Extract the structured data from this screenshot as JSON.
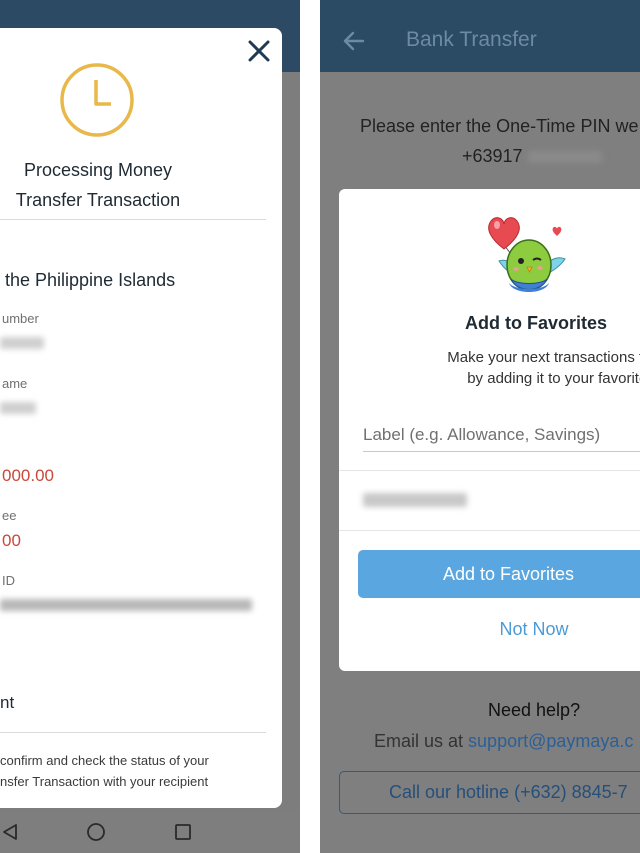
{
  "left_screen": {
    "close_icon": "close-icon",
    "status_icon": "clock-icon",
    "title_line1": "Processing Money",
    "title_line2": "Transfer Transaction",
    "bank_name": "the Philippine Islands",
    "fields": {
      "account_number_label": "umber",
      "account_name_label": "ame",
      "amount_value": "000.00",
      "fee_label": "ee",
      "fee_value": "00",
      "reference_label": "ID"
    },
    "section_title": "nt",
    "note_line1": "confirm and check the status of your",
    "note_line2": "nsfer Transaction with your recipient",
    "colors": {
      "accent": "#e8b84a",
      "amount": "#c7493b",
      "header": "#2c4a63"
    }
  },
  "navigation_bar": {
    "icons": [
      "back-triangle-icon",
      "home-circle-icon",
      "recents-square-icon"
    ]
  },
  "right_screen": {
    "app_bar": {
      "back_icon": "back-arrow-icon",
      "title": "Bank Transfer"
    },
    "otp_prompt": "Please enter the One-Time PIN we",
    "phone_prefix": "+63917",
    "modal": {
      "mascot_icon": "heart-balloon-bird-icon",
      "title": "Add to Favorites",
      "desc_line1": "Make your next transactions fas",
      "desc_line2": "by adding it to your favorites!",
      "label_input": {
        "placeholder": "Label (e.g. Allowance, Savings)",
        "value": ""
      },
      "add_button": "Add to Favorites",
      "not_now_button": "Not Now"
    },
    "help": {
      "title": "Need help?",
      "email_prefix": "Email us at ",
      "email_link": "support@paymaya.c",
      "hotline_button": "Call our hotline (+632) 8845-7"
    },
    "colors": {
      "primary_button": "#5aa6e0",
      "link": "#4b9bd6",
      "header": "#2b4b65"
    }
  }
}
